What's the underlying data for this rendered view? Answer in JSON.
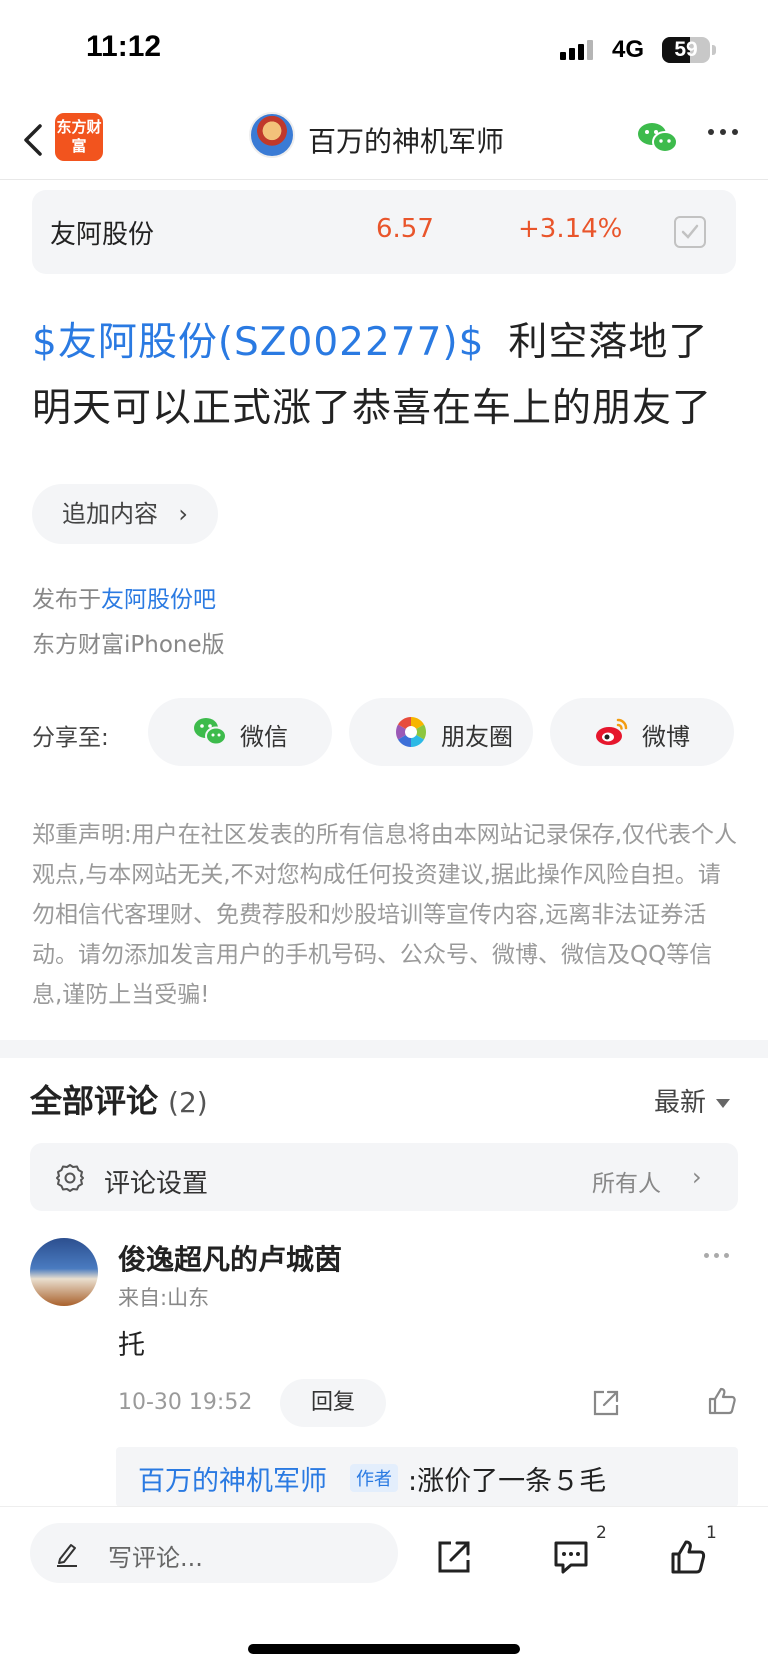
{
  "status_bar": {
    "time": "11:12",
    "network": "4G",
    "battery": "59",
    "battery_level": 0.59
  },
  "nav": {
    "logo_text": "东方财富",
    "title": "百万的神机军师"
  },
  "stock": {
    "name": "友阿股份",
    "price": "6.57",
    "change": "+3.14%"
  },
  "post": {
    "stock_tag": "$友阿股份(SZ002277)$",
    "text": "利空落地了明天可以正式涨了恭喜在车上的朋友了",
    "append_label": "追加内容",
    "published_prefix": "发布于",
    "forum": "友阿股份吧",
    "client": "东方财富iPhone版"
  },
  "share": {
    "label": "分享至:",
    "wechat": "微信",
    "moments": "朋友圈",
    "weibo": "微博"
  },
  "disclaimer": "郑重声明:用户在社区发表的所有信息将由本网站记录保存,仅代表个人观点,与本网站无关,不对您构成任何投资建议,据此操作风险自担。请勿相信代客理财、免费荐股和炒股培训等宣传内容,远离非法证券活动。请勿添加发言用户的手机号码、公众号、微博、微信及QQ等信息,谨防上当受骗!",
  "comments": {
    "title": "全部评论",
    "count": "(2)",
    "sort": "最新",
    "settings_label": "评论设置",
    "settings_value": "所有人",
    "items": [
      {
        "user": "俊逸超凡的卢城茵",
        "from": "来自:山东",
        "body": "托",
        "time": "10-30 19:52",
        "reply_label": "回复",
        "reply": {
          "author": "百万的神机军师",
          "badge": "作者",
          "text": ":涨价了一条５毛"
        }
      }
    ]
  },
  "bottom_bar": {
    "write_placeholder": "写评论...",
    "comment_count": "2",
    "like_count": "1"
  },
  "colors": {
    "accent_blue": "#2a7ae2",
    "up_red": "#e9552b",
    "brand_orange": "#f2541e",
    "wechat_green": "#3dbb4c"
  }
}
